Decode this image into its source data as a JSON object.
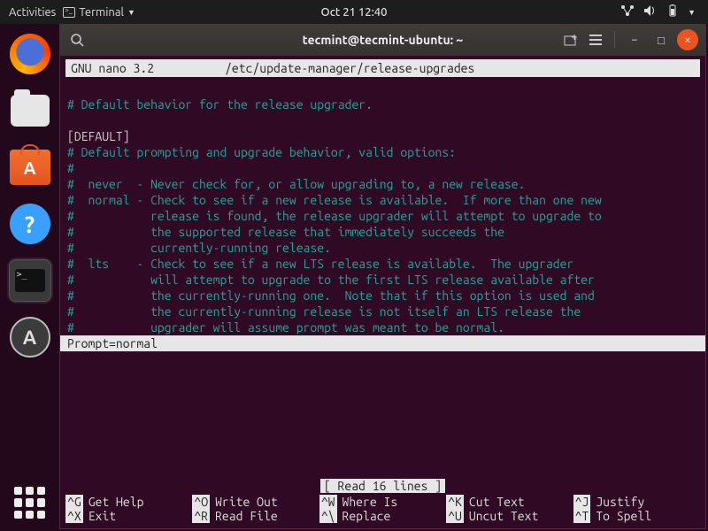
{
  "topbar": {
    "activities": "Activities",
    "app_label": "Terminal",
    "clock": "Oct 21  12:40"
  },
  "dock": {
    "firefox": "Firefox",
    "files": "Files",
    "software": "Ubuntu Software",
    "help": "?",
    "terminal": ">_",
    "updater": "A"
  },
  "terminal": {
    "title": "tecmint@tecmint-ubuntu: ~",
    "search_icon": "search",
    "newtab_icon": "new-tab",
    "menu_icon": "menu",
    "min": "−",
    "max": "□",
    "close": "×"
  },
  "nano": {
    "app": "GNU nano 3.2",
    "file": "/etc/update-manager/release-upgrades",
    "status": "[ Read 16 lines ]",
    "lines": {
      "l1": "# Default behavior for the release upgrader.",
      "l2": "",
      "l3": "[DEFAULT]",
      "l4": "# Default prompting and upgrade behavior, valid options:",
      "l5": "#",
      "l6": "#  never  - Never check for, or allow upgrading to, a new release.",
      "l7": "#  normal - Check to see if a new release is available.  If more than one new",
      "l8": "#           release is found, the release upgrader will attempt to upgrade to",
      "l9": "#           the supported release that immediately succeeds the",
      "l10": "#           currently-running release.",
      "l11": "#  lts    - Check to see if a new LTS release is available.  The upgrader",
      "l12": "#           will attempt to upgrade to the first LTS release available after",
      "l13": "#           the currently-running one.  Note that if this option is used and",
      "l14": "#           the currently-running release is not itself an LTS release the",
      "l15": "#           upgrader will assume prompt was meant to be normal.",
      "l16": "Prompt=normal"
    },
    "shortcuts": {
      "g": {
        "k": "^G",
        "l": "Get Help"
      },
      "o": {
        "k": "^O",
        "l": "Write Out"
      },
      "w": {
        "k": "^W",
        "l": "Where Is"
      },
      "k": {
        "k": "^K",
        "l": "Cut Text"
      },
      "j": {
        "k": "^J",
        "l": "Justify"
      },
      "x": {
        "k": "^X",
        "l": "Exit"
      },
      "r": {
        "k": "^R",
        "l": "Read File"
      },
      "bs": {
        "k": "^\\",
        "l": "Replace"
      },
      "u": {
        "k": "^U",
        "l": "Uncut Text"
      },
      "t": {
        "k": "^T",
        "l": "To Spell"
      }
    }
  }
}
